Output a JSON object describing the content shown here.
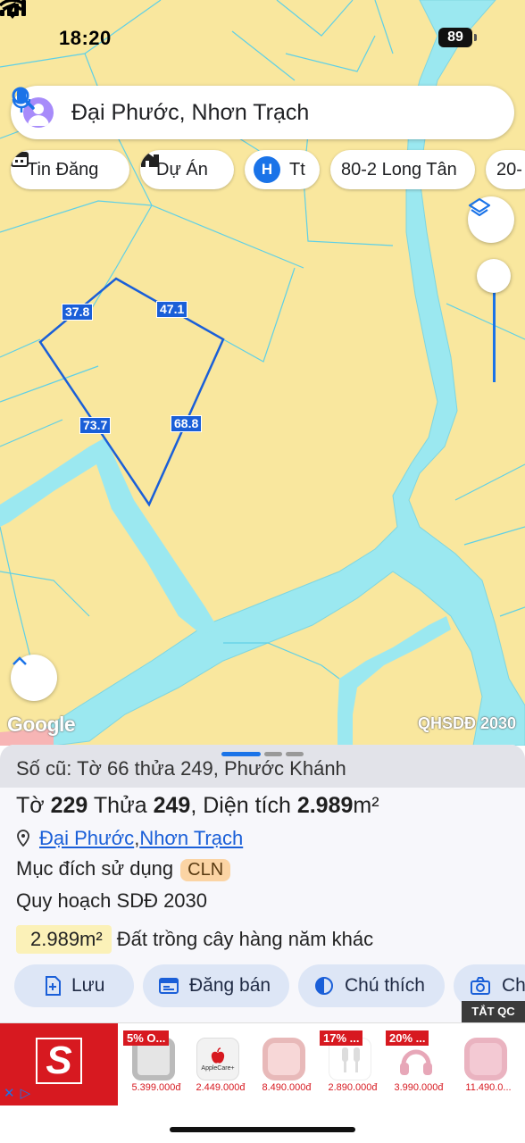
{
  "status_bar": {
    "time": "18:20",
    "battery": "89"
  },
  "search": {
    "query": "Đại Phước, Nhơn Trạch"
  },
  "chips": [
    {
      "label": "Tin Đăng",
      "icon": "calendar-icon"
    },
    {
      "label": "Dự Án",
      "icon": "building-icon"
    },
    {
      "label": "Tt",
      "badge": "H"
    },
    {
      "label": "80-2 Long Tân"
    },
    {
      "label": "20-"
    }
  ],
  "map": {
    "measurements": [
      "37.8",
      "47.1",
      "73.7",
      "68.8"
    ],
    "attribution": "Google",
    "layer_tag": "QHSDĐ 2030",
    "colors": {
      "land": "#f9e79e",
      "water": "#9be8f0",
      "boundary": "#1a5fd8"
    }
  },
  "parcel": {
    "old_info": "Số cũ: Tờ 66 thửa 249, Phước Khánh",
    "title_parts": [
      "Tờ ",
      "229",
      " Thửa ",
      "249",
      ", Diện tích ",
      "2.989",
      "m²"
    ],
    "location": [
      "Đại Phước",
      ", ",
      "Nhơn Trạch"
    ],
    "purpose_label": "Mục đích sử dụng",
    "purpose_code": "CLN",
    "plan_label": "Quy hoạch SDĐ 2030",
    "plan_area": "2.989m²",
    "plan_desc": "Đất trồng cây hàng năm khác"
  },
  "actions": [
    {
      "label": "Lưu",
      "icon": "save-icon"
    },
    {
      "label": "Đăng bán",
      "icon": "post-icon"
    },
    {
      "label": "Chú thích",
      "icon": "legend-icon"
    },
    {
      "label": "Ch",
      "icon": "camera-icon"
    }
  ],
  "ad": {
    "close_label": "TẮT QC",
    "items": [
      {
        "discount": "5% O...",
        "price": "5.399.000đ"
      },
      {
        "discount": "",
        "price": "2.449.000đ",
        "sub": "AppleCare+"
      },
      {
        "discount": "",
        "price": "8.490.000đ"
      },
      {
        "discount": "17% ...",
        "price": "2.890.000đ"
      },
      {
        "discount": "20% ...",
        "price": "3.990.000đ"
      },
      {
        "discount": "",
        "price": "11.490.0..."
      }
    ]
  }
}
